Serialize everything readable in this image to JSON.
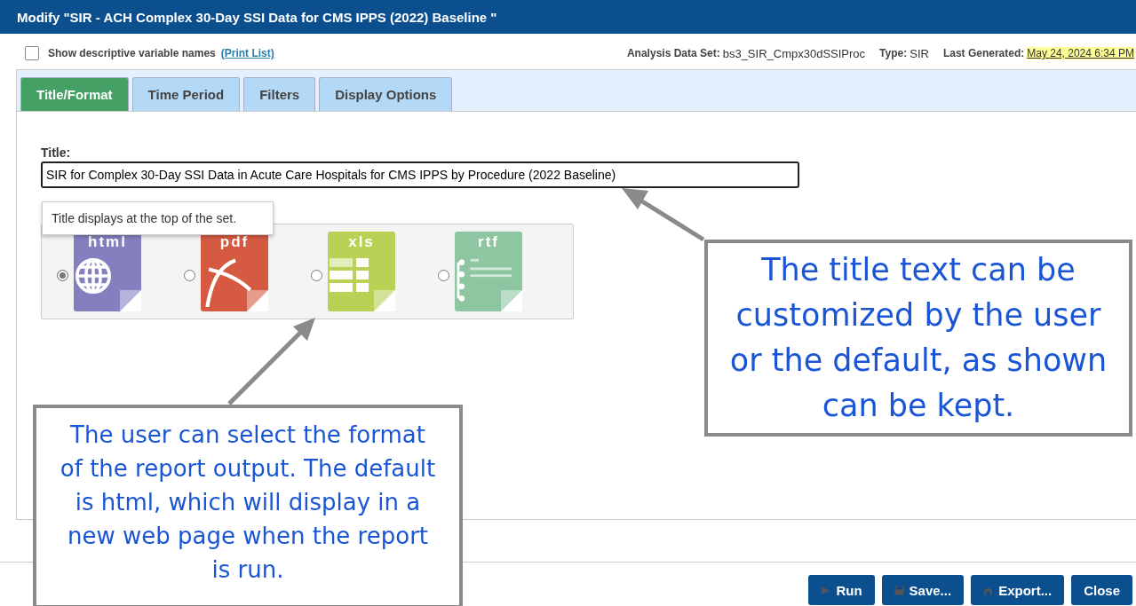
{
  "window": {
    "title": "Modify \"SIR - ACH Complex 30-Day SSI Data for CMS IPPS (2022) Baseline \""
  },
  "options": {
    "show_descriptive": {
      "label": "Show descriptive variable names",
      "checked": false
    },
    "print_link": "(Print List)"
  },
  "info": [
    {
      "label": "Analysis Data Set:",
      "value": "bs3_SIR_Cmpx30dSSIProc",
      "highlight": false
    },
    {
      "label": "Type:",
      "value": "SIR",
      "highlight": false
    },
    {
      "label": "Last Generated:",
      "value": "May 24, 2024 6:34 PM",
      "highlight": true
    }
  ],
  "tabs": [
    {
      "label": "Title/Format",
      "selected": true
    },
    {
      "label": "Time Period",
      "selected": false
    },
    {
      "label": "Filters",
      "selected": false
    },
    {
      "label": "Display Options",
      "selected": false
    }
  ],
  "title_field": {
    "label": "Title:",
    "value": "SIR for Complex 30-Day SSI Data in Acute Care Hospitals for CMS IPPS by Procedure (2022 Baseline)"
  },
  "tooltip": "Title displays at the top of the set.",
  "formats": [
    {
      "label": "html",
      "kind": "web",
      "color": "#8480c0",
      "selected": true
    },
    {
      "label": "pdf",
      "kind": "curve",
      "color": "#d65a42",
      "selected": false
    },
    {
      "label": "xls",
      "kind": "grid",
      "color": "#b9d154",
      "selected": false
    },
    {
      "label": "rtf",
      "kind": "lines",
      "color": "#8ec6a2",
      "selected": false
    }
  ],
  "buttons": [
    {
      "label": "Run",
      "kind": "play"
    },
    {
      "label": "Save...",
      "kind": "disk"
    },
    {
      "label": "Export...",
      "kind": "export"
    },
    {
      "label": "Close",
      "kind": "none"
    }
  ],
  "callouts": [
    {
      "text": "The title text can be customized by the user or the default, as shown can be kept."
    },
    {
      "text": "The user can select the format of the report output. The default is html, which will display in a new web page when the report is run."
    }
  ]
}
